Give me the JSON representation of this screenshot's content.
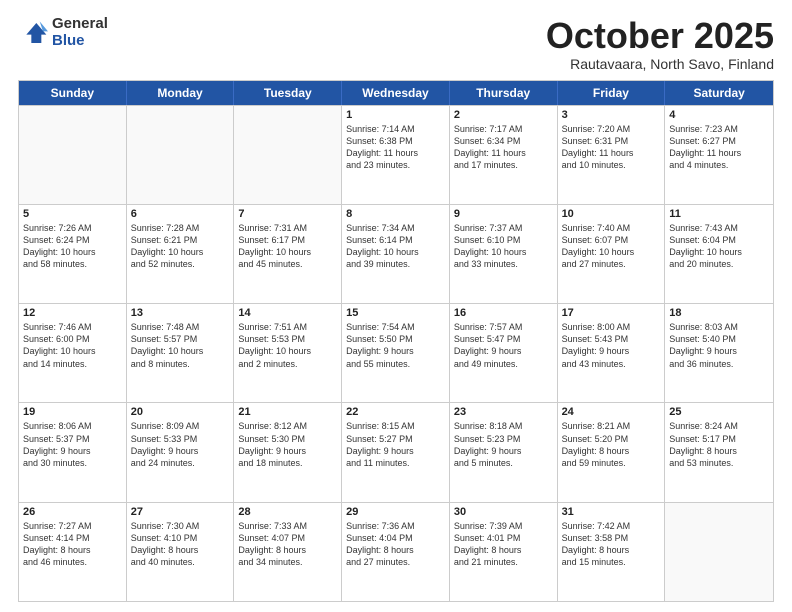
{
  "logo": {
    "general": "General",
    "blue": "Blue"
  },
  "header": {
    "month": "October 2025",
    "location": "Rautavaara, North Savo, Finland"
  },
  "days": [
    "Sunday",
    "Monday",
    "Tuesday",
    "Wednesday",
    "Thursday",
    "Friday",
    "Saturday"
  ],
  "rows": [
    [
      {
        "day": "",
        "info": ""
      },
      {
        "day": "",
        "info": ""
      },
      {
        "day": "",
        "info": ""
      },
      {
        "day": "1",
        "info": "Sunrise: 7:14 AM\nSunset: 6:38 PM\nDaylight: 11 hours\nand 23 minutes."
      },
      {
        "day": "2",
        "info": "Sunrise: 7:17 AM\nSunset: 6:34 PM\nDaylight: 11 hours\nand 17 minutes."
      },
      {
        "day": "3",
        "info": "Sunrise: 7:20 AM\nSunset: 6:31 PM\nDaylight: 11 hours\nand 10 minutes."
      },
      {
        "day": "4",
        "info": "Sunrise: 7:23 AM\nSunset: 6:27 PM\nDaylight: 11 hours\nand 4 minutes."
      }
    ],
    [
      {
        "day": "5",
        "info": "Sunrise: 7:26 AM\nSunset: 6:24 PM\nDaylight: 10 hours\nand 58 minutes."
      },
      {
        "day": "6",
        "info": "Sunrise: 7:28 AM\nSunset: 6:21 PM\nDaylight: 10 hours\nand 52 minutes."
      },
      {
        "day": "7",
        "info": "Sunrise: 7:31 AM\nSunset: 6:17 PM\nDaylight: 10 hours\nand 45 minutes."
      },
      {
        "day": "8",
        "info": "Sunrise: 7:34 AM\nSunset: 6:14 PM\nDaylight: 10 hours\nand 39 minutes."
      },
      {
        "day": "9",
        "info": "Sunrise: 7:37 AM\nSunset: 6:10 PM\nDaylight: 10 hours\nand 33 minutes."
      },
      {
        "day": "10",
        "info": "Sunrise: 7:40 AM\nSunset: 6:07 PM\nDaylight: 10 hours\nand 27 minutes."
      },
      {
        "day": "11",
        "info": "Sunrise: 7:43 AM\nSunset: 6:04 PM\nDaylight: 10 hours\nand 20 minutes."
      }
    ],
    [
      {
        "day": "12",
        "info": "Sunrise: 7:46 AM\nSunset: 6:00 PM\nDaylight: 10 hours\nand 14 minutes."
      },
      {
        "day": "13",
        "info": "Sunrise: 7:48 AM\nSunset: 5:57 PM\nDaylight: 10 hours\nand 8 minutes."
      },
      {
        "day": "14",
        "info": "Sunrise: 7:51 AM\nSunset: 5:53 PM\nDaylight: 10 hours\nand 2 minutes."
      },
      {
        "day": "15",
        "info": "Sunrise: 7:54 AM\nSunset: 5:50 PM\nDaylight: 9 hours\nand 55 minutes."
      },
      {
        "day": "16",
        "info": "Sunrise: 7:57 AM\nSunset: 5:47 PM\nDaylight: 9 hours\nand 49 minutes."
      },
      {
        "day": "17",
        "info": "Sunrise: 8:00 AM\nSunset: 5:43 PM\nDaylight: 9 hours\nand 43 minutes."
      },
      {
        "day": "18",
        "info": "Sunrise: 8:03 AM\nSunset: 5:40 PM\nDaylight: 9 hours\nand 36 minutes."
      }
    ],
    [
      {
        "day": "19",
        "info": "Sunrise: 8:06 AM\nSunset: 5:37 PM\nDaylight: 9 hours\nand 30 minutes."
      },
      {
        "day": "20",
        "info": "Sunrise: 8:09 AM\nSunset: 5:33 PM\nDaylight: 9 hours\nand 24 minutes."
      },
      {
        "day": "21",
        "info": "Sunrise: 8:12 AM\nSunset: 5:30 PM\nDaylight: 9 hours\nand 18 minutes."
      },
      {
        "day": "22",
        "info": "Sunrise: 8:15 AM\nSunset: 5:27 PM\nDaylight: 9 hours\nand 11 minutes."
      },
      {
        "day": "23",
        "info": "Sunrise: 8:18 AM\nSunset: 5:23 PM\nDaylight: 9 hours\nand 5 minutes."
      },
      {
        "day": "24",
        "info": "Sunrise: 8:21 AM\nSunset: 5:20 PM\nDaylight: 8 hours\nand 59 minutes."
      },
      {
        "day": "25",
        "info": "Sunrise: 8:24 AM\nSunset: 5:17 PM\nDaylight: 8 hours\nand 53 minutes."
      }
    ],
    [
      {
        "day": "26",
        "info": "Sunrise: 7:27 AM\nSunset: 4:14 PM\nDaylight: 8 hours\nand 46 minutes."
      },
      {
        "day": "27",
        "info": "Sunrise: 7:30 AM\nSunset: 4:10 PM\nDaylight: 8 hours\nand 40 minutes."
      },
      {
        "day": "28",
        "info": "Sunrise: 7:33 AM\nSunset: 4:07 PM\nDaylight: 8 hours\nand 34 minutes."
      },
      {
        "day": "29",
        "info": "Sunrise: 7:36 AM\nSunset: 4:04 PM\nDaylight: 8 hours\nand 27 minutes."
      },
      {
        "day": "30",
        "info": "Sunrise: 7:39 AM\nSunset: 4:01 PM\nDaylight: 8 hours\nand 21 minutes."
      },
      {
        "day": "31",
        "info": "Sunrise: 7:42 AM\nSunset: 3:58 PM\nDaylight: 8 hours\nand 15 minutes."
      },
      {
        "day": "",
        "info": ""
      }
    ]
  ]
}
